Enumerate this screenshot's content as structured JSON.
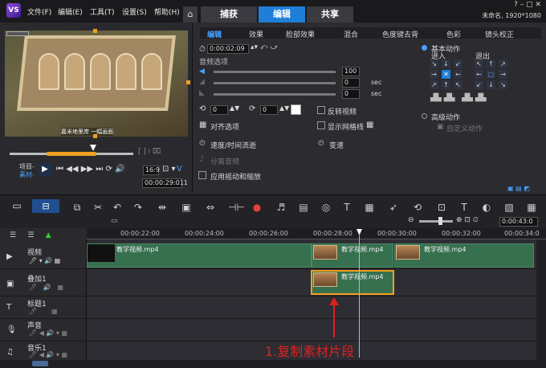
{
  "app": {
    "logo": "VS",
    "status": "未命名, 1920*1080"
  },
  "menu": [
    "文件(F)",
    "编辑(E)",
    "工具(T)",
    "设置(S)",
    "帮助(H)"
  ],
  "tabs": {
    "capture": "捕获",
    "edit": "编辑",
    "share": "共享"
  },
  "preview": {
    "caption": "嘉米地里岸 一幅画面",
    "project_label": "项目-",
    "clip_label": "素材-",
    "timecode": "00:00:29:011",
    "ratio": "16:9"
  },
  "options": {
    "tabs": [
      "编辑",
      "效果",
      "脸部效果",
      "混合",
      "色度键去背",
      "色彩",
      "镜头校正"
    ],
    "duration": "0:00:02:09",
    "audio_section": "音频选项",
    "audio_values": [
      "100",
      "0",
      "0"
    ],
    "sec": "sec",
    "rotate_a": "0",
    "rotate_b": "0",
    "align": "对齐选项",
    "speed": "速度/时间流逝",
    "split_audio": "分离音频",
    "pan_zoom": "应用摇动和缩放",
    "reverse": "反转视频",
    "grid": "显示网格线",
    "variable_speed": "变速",
    "basic_motion": "基本动作",
    "enter": "进入",
    "exit": "退出",
    "advanced_motion": "高级动作",
    "custom_motion": "自定义动作"
  },
  "timeline": {
    "timecode": "0:00:43:0",
    "ruler": [
      "00:00:22:00",
      "00:00:24:00",
      "00:00:26:00",
      "00:00:28:00",
      "00:00:30:00",
      "00:00:32:00",
      "00:00:34:0"
    ],
    "tracks": [
      {
        "name": "视频",
        "clips": [
          "教学视频.mp4",
          "教学视频.mp4",
          "教学视频.mp4"
        ]
      },
      {
        "name": "叠加1",
        "clips": [
          "教学视频.mp4"
        ]
      },
      {
        "name": "标题1",
        "clips": []
      },
      {
        "name": "声音",
        "clips": []
      },
      {
        "name": "音乐1",
        "clips": []
      }
    ],
    "annotation": "1.复制素材片段"
  },
  "colors": {
    "accent": "#1f7fd8",
    "clip": "#36704f",
    "selection": "#f0a020",
    "annotation": "#e02020"
  }
}
